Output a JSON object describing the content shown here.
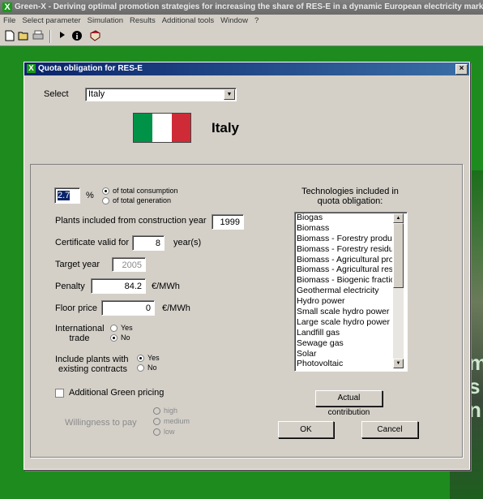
{
  "app": {
    "title": "Green-X - Deriving optimal promotion strategies for increasing the share of RES-E in a dynamic European electricity market",
    "logo_glyph": "X",
    "menu": [
      "File",
      "Select parameter",
      "Simulation",
      "Results",
      "Additional tools",
      "Window",
      "?"
    ],
    "toolbar_icons": [
      "new-file-icon",
      "open-folder-icon",
      "print-icon",
      "play-icon",
      "info-icon",
      "help-book-icon"
    ]
  },
  "background": {
    "texts": [
      "m",
      "s",
      "n"
    ]
  },
  "dialog": {
    "title": "Quota obligation for RES-E",
    "close": "×",
    "select_label": "Select",
    "country": "Italy",
    "country_heading": "Italy",
    "flag_colors": [
      "#009246",
      "#ffffff",
      "#ce2b37"
    ],
    "quota": {
      "value": "2.7",
      "unit": "%",
      "options": [
        "of total consumption",
        "of total generation"
      ],
      "selected": 0
    },
    "construction_year": {
      "label": "Plants included from construction year",
      "value": "1999"
    },
    "certificate": {
      "label": "Certificate valid for",
      "value": "8",
      "unit": "year(s)"
    },
    "target_year": {
      "label": "Target year",
      "value": "2005"
    },
    "penalty": {
      "label": "Penalty",
      "value": "84.2",
      "unit": "€/MWh"
    },
    "floor_price": {
      "label": "Floor price",
      "value": "0",
      "unit": "€/MWh"
    },
    "international_trade": {
      "label_line1": "International",
      "label_line2": "trade",
      "options": [
        "Yes",
        "No"
      ],
      "selected": 1
    },
    "existing_contracts": {
      "label_line1": "Include plants with",
      "label_line2": "existing contracts",
      "options": [
        "Yes",
        "No"
      ],
      "selected": 0
    },
    "green_pricing": {
      "label": "Additional Green pricing",
      "checked": false
    },
    "willingness": {
      "label": "Willingness to pay",
      "options": [
        "high",
        "medium",
        "low"
      ]
    },
    "technologies": {
      "heading_line1": "Technologies included in",
      "heading_line2": "quota obligation:",
      "items": [
        "Biogas",
        "Biomass",
        "Biomass - Forestry produ",
        "Biomass - Forestry residu",
        "Biomass - Agricultural pro",
        "Biomass - Agricultural res",
        "Biomass - Biogenic fractio",
        "Geothermal electricity",
        "Hydro power",
        "Small scale hydro power",
        "Large scale hydro power",
        "Landfill gas",
        "Sewage gas",
        "Solar",
        "Photovoltaic"
      ]
    },
    "buttons": {
      "actual_contribution": "Actual contribution",
      "ok": "OK",
      "cancel": "Cancel"
    }
  }
}
